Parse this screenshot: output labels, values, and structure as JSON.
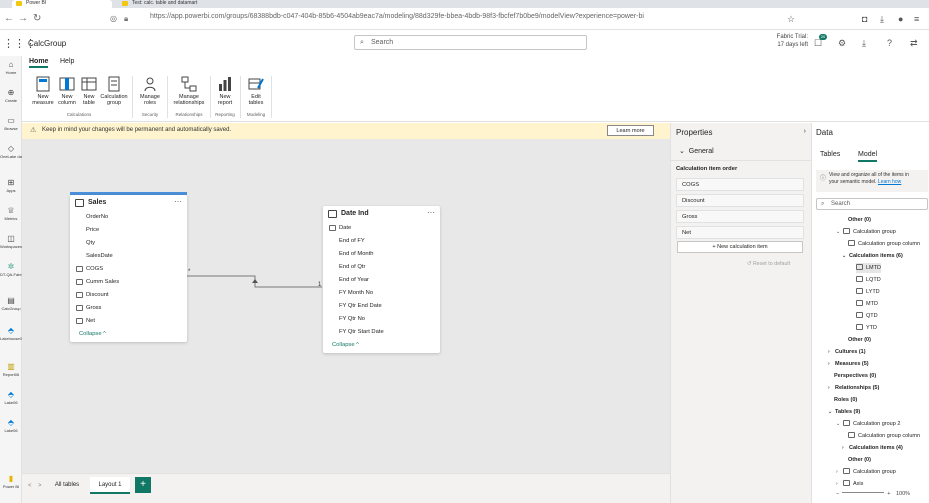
{
  "browser": {
    "tab1": "Power BI",
    "tab2": "Test: calc. table and datamart",
    "url": "https://app.powerbi.com/groups/68388bdb-c047-404b-85b6-4504ab9eac7a/modeling/88d329fe-bbea-4bdb-98f3-fbcfef7b0be9/modelView?experience=power-bi"
  },
  "header": {
    "app_name": "CalcGroup",
    "search_placeholder": "Search",
    "trial_line1": "Fabric Trial:",
    "trial_line2": "17 days left",
    "notif_count": "20"
  },
  "leftnav": [
    {
      "icon": "home",
      "label": "Home"
    },
    {
      "icon": "create",
      "label": "Create"
    },
    {
      "icon": "browse",
      "label": "Browse"
    },
    {
      "icon": "datahub",
      "label": "OneLake data hub"
    },
    {
      "icon": "apps",
      "label": "Apps"
    },
    {
      "icon": "metrics",
      "label": "Metrics"
    },
    {
      "icon": "workspaces",
      "label": "Workspaces"
    },
    {
      "icon": "fabric",
      "label": "DT-QA-Fabric"
    },
    {
      "icon": "calcgroup",
      "label": "CalcGroup"
    },
    {
      "icon": "lakehouse",
      "label": "Lakehouse06"
    },
    {
      "icon": "report",
      "label": "Report06"
    },
    {
      "icon": "lake1",
      "label": "Lake06"
    },
    {
      "icon": "lake2",
      "label": "Lake06"
    },
    {
      "icon": "powerbi",
      "label": "Power BI"
    }
  ],
  "ribbon": {
    "tabs": [
      "Home",
      "Help"
    ],
    "buttons": [
      {
        "label1": "New",
        "label2": "measure"
      },
      {
        "label1": "New",
        "label2": "column"
      },
      {
        "label1": "New",
        "label2": "table"
      },
      {
        "label1": "Calculation",
        "label2": "group"
      },
      {
        "label1": "Manage",
        "label2": "roles"
      },
      {
        "label1": "Manage",
        "label2": "relationships"
      },
      {
        "label1": "New",
        "label2": "report"
      },
      {
        "label1": "Edit",
        "label2": "tables"
      }
    ],
    "groups": [
      "Calculations",
      "Security",
      "Relationships",
      "Reporting",
      "Modeling"
    ]
  },
  "warning": {
    "text": "Keep in mind your changes will be permanent and automatically saved.",
    "button": "Learn more"
  },
  "canvas": {
    "sales": {
      "title": "Sales",
      "fields": [
        "OrderNo",
        "Price",
        "Qty",
        "SalesDate",
        "COGS",
        "Cumm Sales",
        "Discount",
        "Gross",
        "Net"
      ],
      "collapse": "Collapse ^"
    },
    "dateind": {
      "title": "Date Ind",
      "fields": [
        "Date",
        "End of FY",
        "End of Month",
        "End of Qtr",
        "End of Year",
        "FY Month No",
        "FY Qtr End Date",
        "FY Qtr No",
        "FY Qtr Start Date"
      ],
      "collapse": "Collapse ^"
    },
    "rel_many": "*",
    "rel_one": "1"
  },
  "bottombar": {
    "tabs": [
      "All tables",
      "Layout 1"
    ],
    "add": "+"
  },
  "properties": {
    "title": "Properties",
    "section": "General",
    "label": "Calculation item order",
    "items": [
      "COGS",
      "Discount",
      "Gross",
      "Net"
    ],
    "new_item": "+ New calculation item",
    "reset": "Reset to default"
  },
  "datapane": {
    "title": "Data",
    "tabs": [
      "Tables",
      "Model"
    ],
    "info_line1": "View and organize all of the items in",
    "info_line2": "your semantic model.",
    "info_link": "Learn how",
    "search_placeholder": "Search",
    "tree": [
      {
        "text": "Other (0)",
        "bold": true
      },
      {
        "text": "Calculation group",
        "chev": "v",
        "box": true
      },
      {
        "text": "Calculation group column",
        "box": true
      },
      {
        "text": "Calculation items (6)",
        "chev": "v",
        "bold": true
      },
      {
        "text": "LMTD",
        "box": true
      },
      {
        "text": "LQTD",
        "box": true
      },
      {
        "text": "LYTD",
        "box": true
      },
      {
        "text": "MTD",
        "box": true
      },
      {
        "text": "QTD",
        "box": true
      },
      {
        "text": "YTD",
        "box": true
      },
      {
        "text": "Other (0)",
        "bold": true
      },
      {
        "text": "Cultures (1)",
        "chev": ">",
        "bold": true
      },
      {
        "text": "Measures (5)",
        "chev": ">",
        "bold": true
      },
      {
        "text": "Perspectives (0)",
        "bold": true
      },
      {
        "text": "Relationships (5)",
        "chev": ">",
        "bold": true
      },
      {
        "text": "Roles (0)",
        "bold": true
      },
      {
        "text": "Tables (9)",
        "chev": "v",
        "bold": true
      },
      {
        "text": "Calculation group 2",
        "chev": "v",
        "box": true
      },
      {
        "text": "Calculation group column",
        "box": true
      },
      {
        "text": "Calculation items (4)",
        "chev": ">",
        "bold": true
      },
      {
        "text": "Other (0)",
        "bold": true
      },
      {
        "text": "Calculation group",
        "chev": ">",
        "box": true
      },
      {
        "text": "Axis",
        "chev": ">",
        "box": true
      }
    ],
    "zoom": "100%"
  }
}
